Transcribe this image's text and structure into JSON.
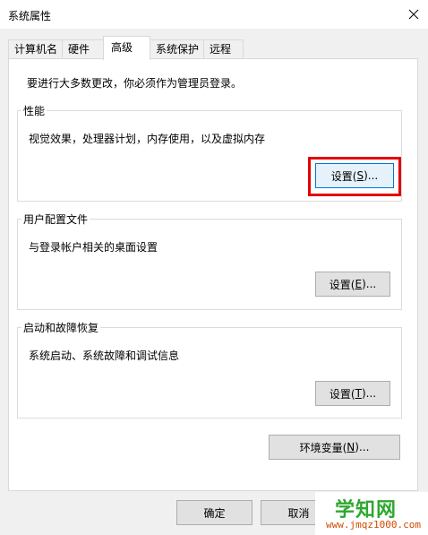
{
  "window": {
    "title": "系统属性",
    "close_icon": "close-icon"
  },
  "tabs": [
    {
      "label": "计算机名",
      "active": false
    },
    {
      "label": "硬件",
      "active": false
    },
    {
      "label": "高级",
      "active": true
    },
    {
      "label": "系统保护",
      "active": false
    },
    {
      "label": "远程",
      "active": false
    }
  ],
  "advanced": {
    "admin_note": "要进行大多数更改，你必须作为管理员登录。",
    "performance": {
      "title": "性能",
      "description": "视觉效果，处理器计划，内存使用，以及虚拟内存",
      "button": {
        "text": "设置(",
        "accel": "S",
        "suffix": ")..."
      }
    },
    "user_profiles": {
      "title": "用户配置文件",
      "description": "与登录帐户相关的桌面设置",
      "button": {
        "text": "设置(",
        "accel": "E",
        "suffix": ")..."
      }
    },
    "startup_recovery": {
      "title": "启动和故障恢复",
      "description": "系统启动、系统故障和调试信息",
      "button": {
        "text": "设置(",
        "accel": "T",
        "suffix": ")..."
      }
    },
    "env_button": {
      "text": "环境变量(",
      "accel": "N",
      "suffix": ")..."
    }
  },
  "footer": {
    "ok": "确定",
    "cancel": "取消"
  },
  "watermark": {
    "logo": "学知网",
    "url": "www.jmqz1000.com"
  },
  "colors": {
    "highlight": "#e30000",
    "focus": "#0078d7"
  }
}
